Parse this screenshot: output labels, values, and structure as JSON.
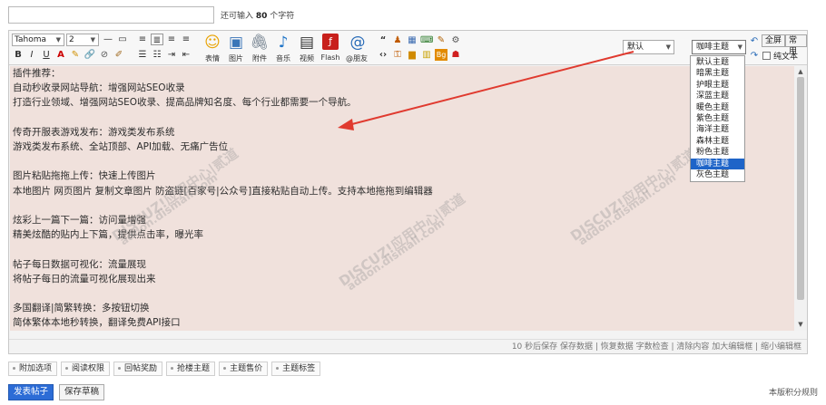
{
  "title_field": {
    "value": "",
    "hint_prefix": "还可输入",
    "hint_count": "80",
    "hint_suffix": "个字符"
  },
  "toolbar": {
    "font_family": "Tahoma",
    "font_size": "2",
    "buttons": {
      "bold": "B",
      "italic": "I",
      "underline": "U",
      "expression": "表情",
      "image": "图片",
      "attachment": "附件",
      "music": "音乐",
      "video": "视频",
      "flash": "Flash",
      "at_friend": "@朋友"
    },
    "default_select": "默认",
    "theme_select": "咖啡主题",
    "fullscreen": "全屏",
    "common": "常用",
    "plain_text": "纯文本"
  },
  "theme_options": [
    "默认主题",
    "暗黑主题",
    "护眼主题",
    "深蓝主题",
    "暖色主题",
    "紫色主题",
    "海洋主题",
    "森林主题",
    "粉色主题",
    "咖啡主题",
    "灰色主题"
  ],
  "theme_active": "咖啡主题",
  "content_lines": [
    "插件推荐：",
    "自动秒收录网站导航：增强网站SEO收录",
    "打造行业领域、增强网站SEO收录、提高品牌知名度、每个行业都需要一个导航。",
    "",
    "传奇开服表游戏发布：游戏类发布系统",
    "游戏类发布系统、全站顶部、API加载、无痛广告位",
    "",
    "图片粘贴拖拖上传：快速上传图片",
    "本地图片 网页图片 复制文章图片 防盗链[百家号|公众号]直接粘贴自动上传。支持本地拖拖到编辑器",
    "",
    "炫彩上一篇下一篇：访问量增强",
    "精美炫酷的贴内上下篇，提供点击率，曝光率",
    "",
    "帖子每日数据可视化：流量展现",
    "将帖子每日的流量可视化展现出来",
    "",
    "多国翻译|简繁转换：多按钮切换",
    "简体繁体本地秒转换，翻译免费API接口"
  ],
  "watermarks": {
    "brand": "DISCUZ!应用中心|贰道",
    "domain": "addon.dismall.com"
  },
  "statusbar": "10 秒后保存 保存数据 | 恢复数据    字数检查 | 清除内容    加大编辑框 | 缩小编辑框",
  "tabs": [
    "附加选项",
    "阅读权限",
    "回帖奖励",
    "抢楼主题",
    "主题售价",
    "主题标签"
  ],
  "actions": {
    "publish": "发表帖子",
    "save_draft": "保存草稿",
    "rules": "本版积分规则"
  },
  "colors": {
    "content_bg": "#f0e1dc",
    "accent": "#2c6cd6",
    "arrow": "#e03a2f",
    "active_option": "#1e64c8"
  }
}
